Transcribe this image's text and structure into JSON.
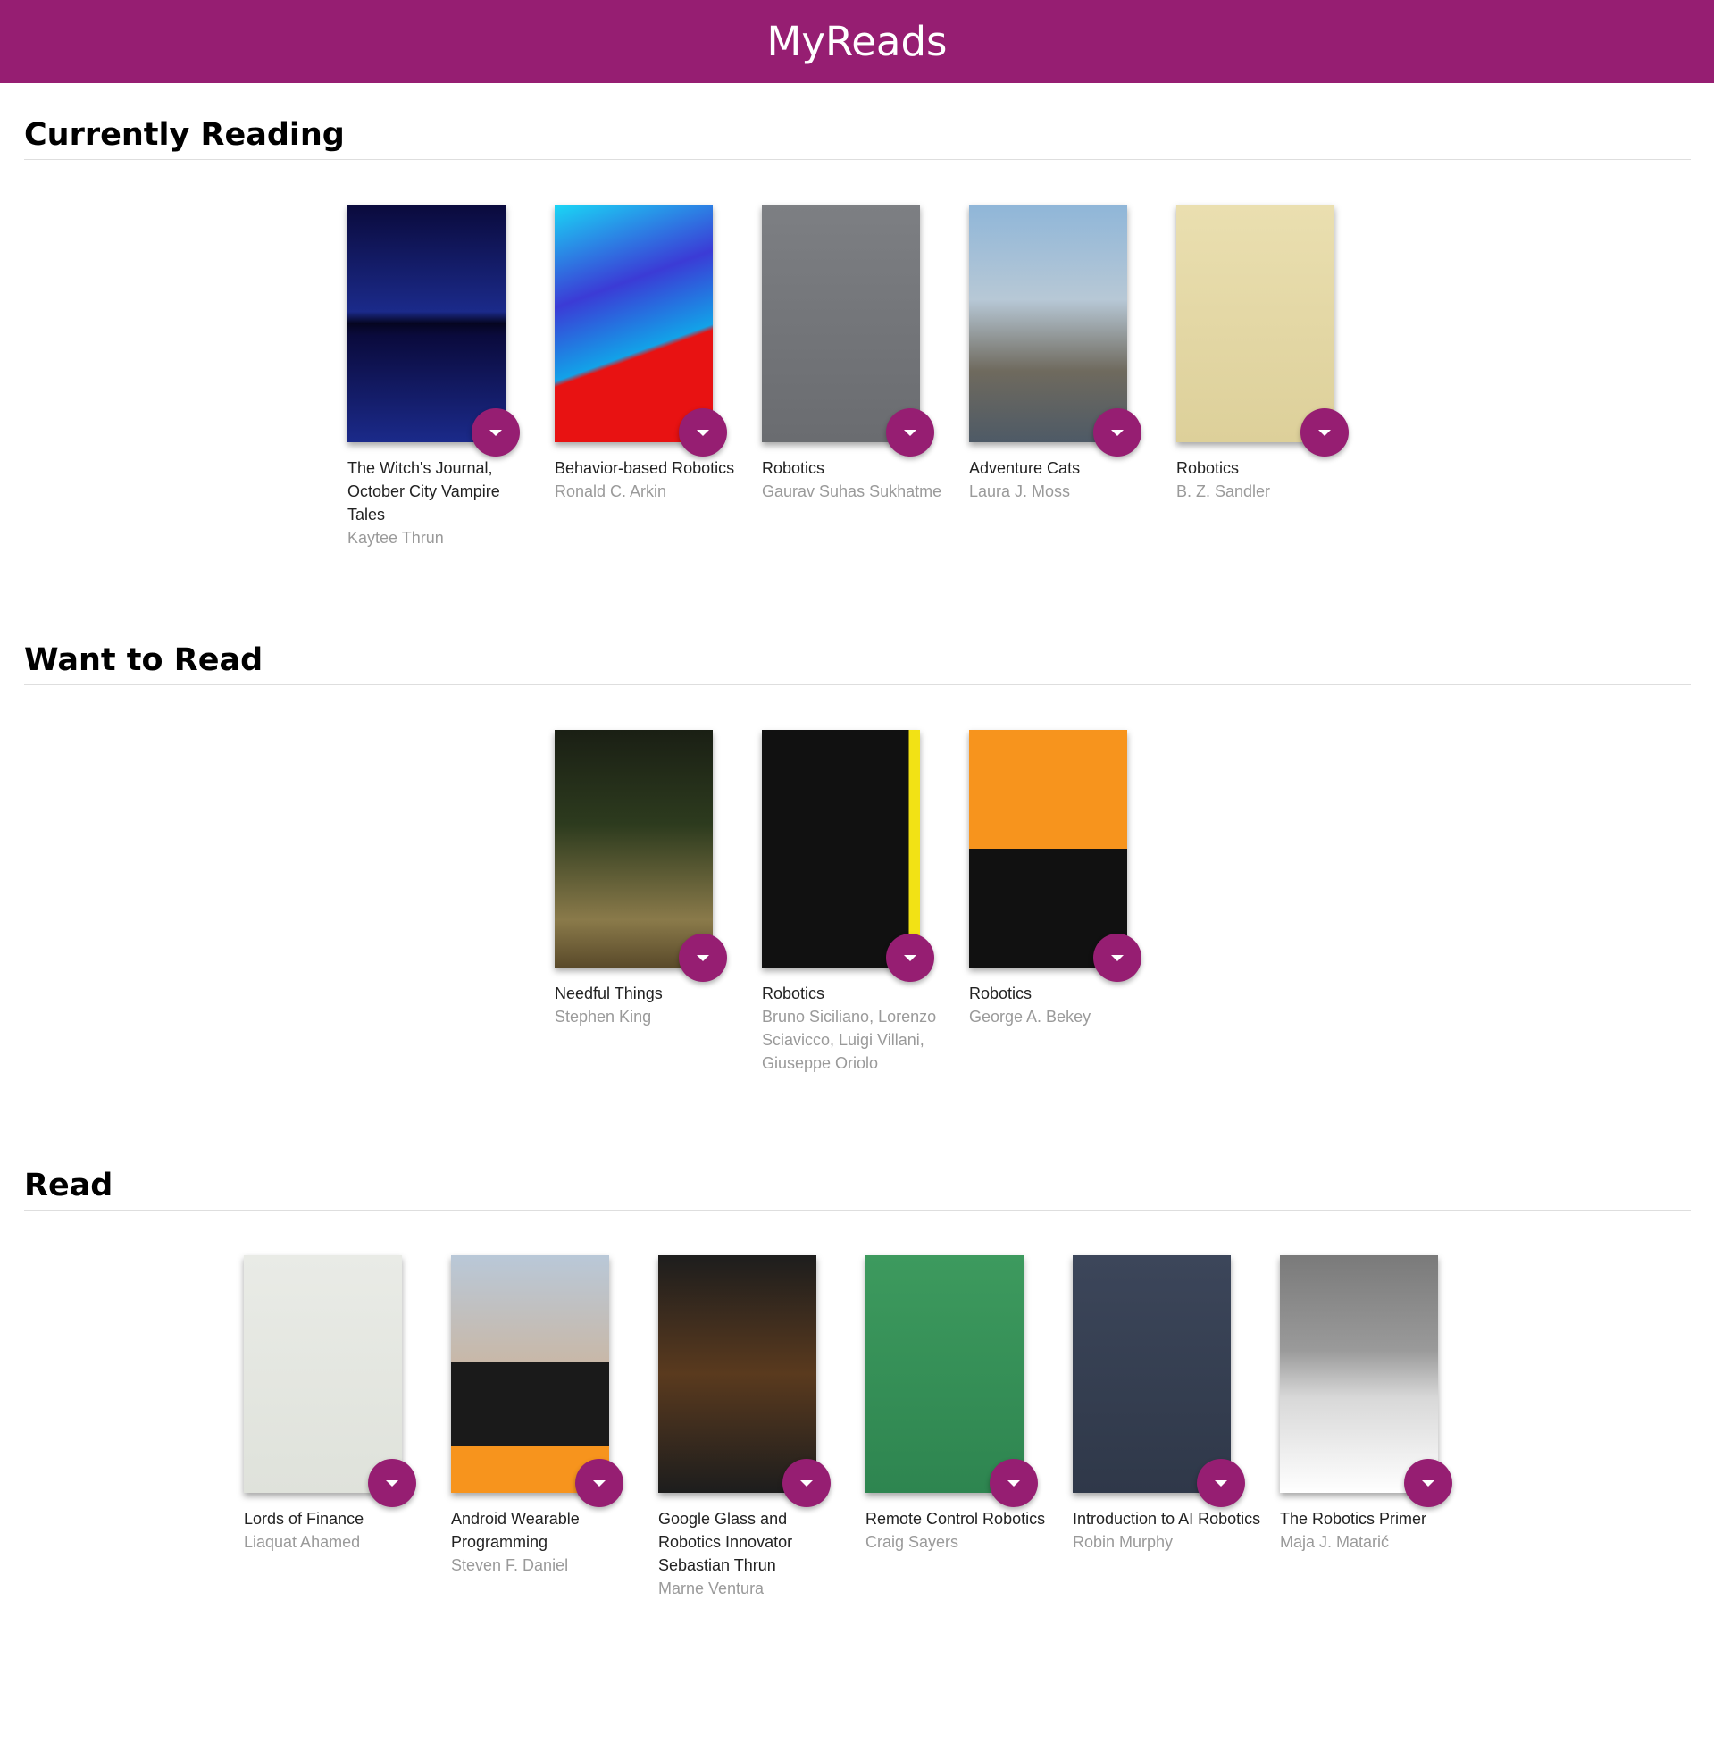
{
  "app": {
    "title": "MyReads",
    "header_color": "#961e72"
  },
  "shelves": [
    {
      "title": "Currently Reading",
      "books": [
        {
          "title": "The Witch's Journal, October City Vampire Tales",
          "authors": "Kaytee Thrun",
          "cover": {
            "bg": "linear-gradient(180deg,#0a0a3c 0%,#1b2a8a 45%,#050520 50%,#0a0a3c 55%,#1b2a8a 100%)",
            "fg": "#ffffff",
            "text": ""
          }
        },
        {
          "title": "Behavior-based Robotics",
          "authors": "Ronald C. Arkin",
          "cover": {
            "bg": "linear-gradient(160deg,#1ad6f5 0%,#3b3bd6 35%,#12a2e8 60%,#e81212 62%,#e81212 100%)",
            "fg": "#f5d419",
            "text": ""
          }
        },
        {
          "title": "Robotics",
          "authors": "Gaurav Suhas Sukhatme",
          "cover": {
            "bg": "linear-gradient(180deg,#7d7f83 0%,#6a6c70 100%)",
            "fg": "#c9cbd0",
            "text": ""
          }
        },
        {
          "title": "Adventure Cats",
          "authors": "Laura J. Moss",
          "cover": {
            "bg": "linear-gradient(180deg,#8fb6d8 0%,#b7c8d6 40%,#6f6a5e 70%,#4e5a66 100%)",
            "fg": "#f58b1c",
            "text": ""
          }
        },
        {
          "title": "Robotics",
          "authors": "B. Z. Sandler",
          "cover": {
            "bg": "linear-gradient(180deg,#eadfb0 0%,#ddd09a 100%)",
            "fg": "#8a1b1b",
            "text": ""
          }
        }
      ]
    },
    {
      "title": "Want to Read",
      "books": [
        {
          "title": "Needful Things",
          "authors": "Stephen King",
          "cover": {
            "bg": "linear-gradient(180deg,#1a1f14 0%,#2d3b1e 40%,#8a7a4a 80%,#5a4a2a 100%)",
            "fg": "#7ed321",
            "text": ""
          }
        },
        {
          "title": "Robotics",
          "authors": "Bruno Siciliano, Lorenzo Sciavicco, Luigi Villani, Giuseppe Oriolo",
          "cover": {
            "bg": "linear-gradient(90deg,#111 0%,#111 93%,#f2e215 93%,#f2e215 100%)",
            "fg": "#f2e215",
            "text": ""
          }
        },
        {
          "title": "Robotics",
          "authors": "George A. Bekey",
          "cover": {
            "bg": "linear-gradient(180deg,#f7941d 0%,#f7941d 50%,#111111 50%,#111111 100%)",
            "fg": "#c2171e",
            "text": ""
          }
        }
      ]
    },
    {
      "title": "Read",
      "books": [
        {
          "title": "Lords of Finance",
          "authors": "Liaquat Ahamed",
          "cover": {
            "bg": "linear-gradient(180deg,#e9ebe6 0%,#dfe2db 100%)",
            "fg": "#333333",
            "text": ""
          }
        },
        {
          "title": "Android Wearable Programming",
          "authors": "Steven F. Daniel",
          "cover": {
            "bg": "linear-gradient(180deg,#b9c8d8 0%,#c8b8a8 45%,#1a1a1a 45%,#1a1a1a 80%,#f7941d 80%,#f7941d 100%)",
            "fg": "#ffffff",
            "text": ""
          }
        },
        {
          "title": "Google Glass and Robotics Innovator Sebastian Thrun",
          "authors": "Marne Ventura",
          "cover": {
            "bg": "linear-gradient(180deg,#1d1d1d 0%,#5a3a1e 50%,#1d1d1d 100%)",
            "fg": "#f5a623",
            "text": ""
          }
        },
        {
          "title": "Remote Control Robotics",
          "authors": "Craig Sayers",
          "cover": {
            "bg": "linear-gradient(180deg,#3d9a5e 0%,#2e8550 100%)",
            "fg": "#e8f5e8",
            "text": ""
          }
        },
        {
          "title": "Introduction to AI Robotics",
          "authors": "Robin Murphy",
          "cover": {
            "bg": "linear-gradient(180deg,#3c465a 0%,#2f3849 100%)",
            "fg": "#ffffff",
            "text": ""
          }
        },
        {
          "title": "The Robotics Primer",
          "authors": "Maja J. Matarić",
          "cover": {
            "bg": "linear-gradient(180deg,#7a7a7a 0%,#9a9a9a 40%,#d8d8d8 60%,#ffffff 100%)",
            "fg": "#8a1b1b",
            "text": ""
          }
        }
      ]
    }
  ]
}
